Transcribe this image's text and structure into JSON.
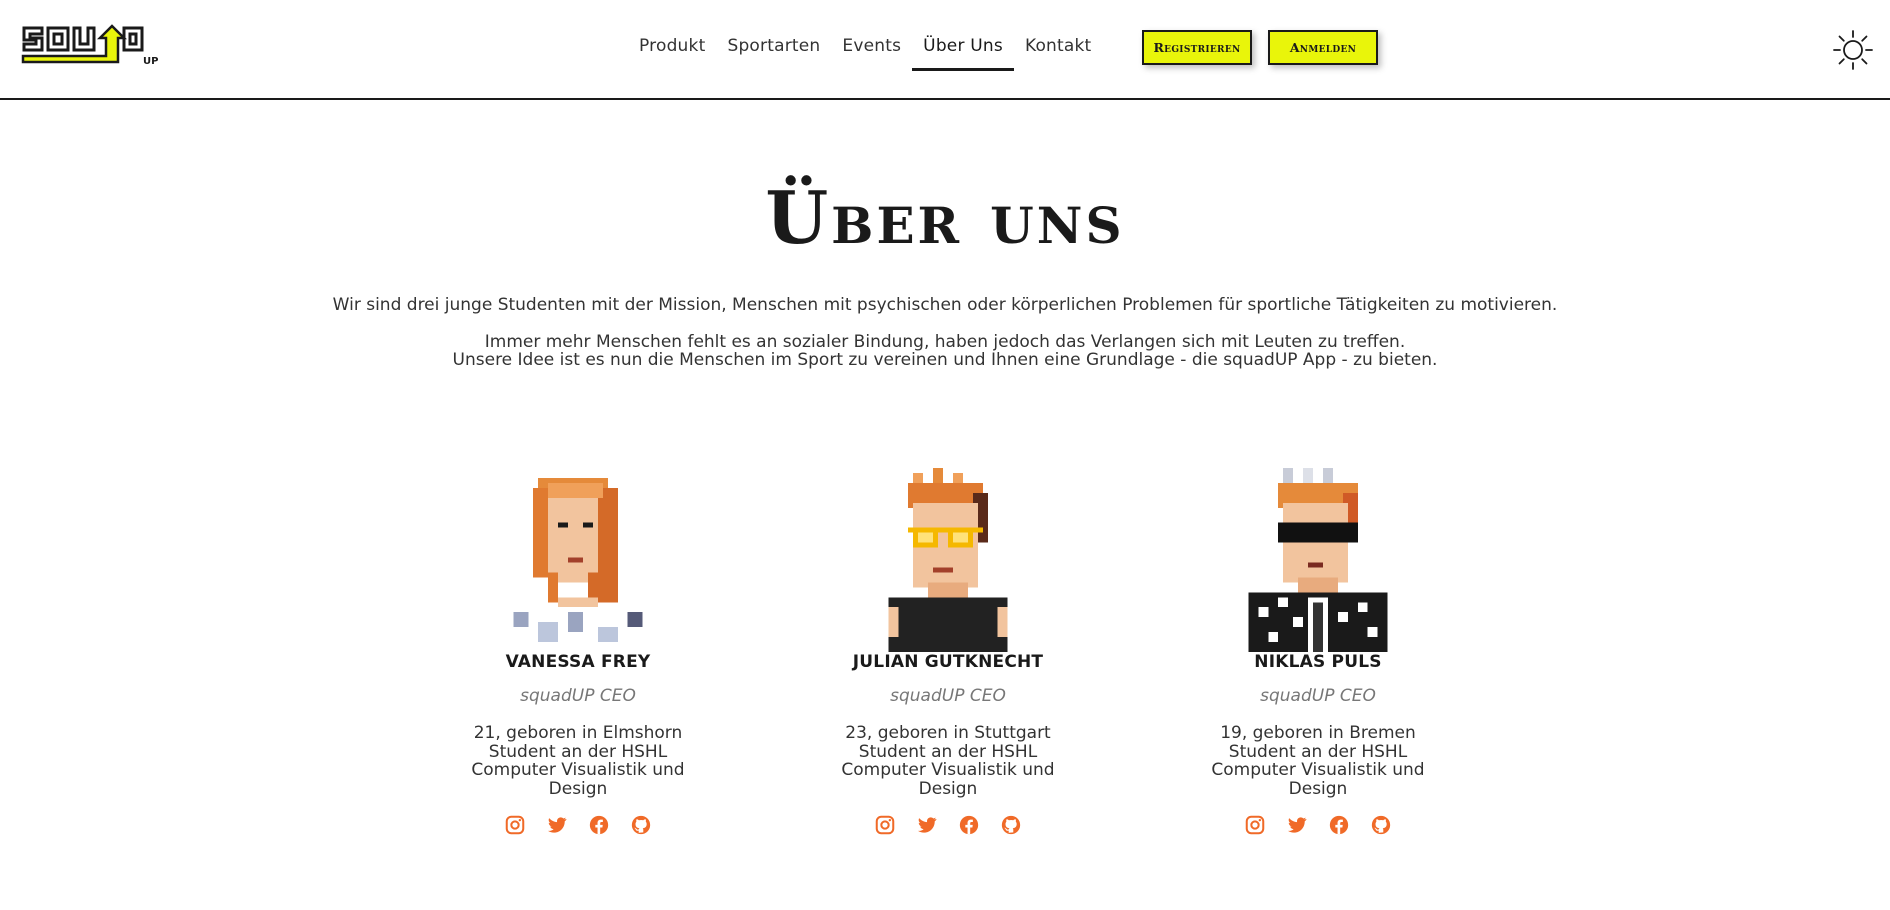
{
  "nav": {
    "items": [
      {
        "label": "Produkt",
        "active": false
      },
      {
        "label": "Sportarten",
        "active": false
      },
      {
        "label": "Events",
        "active": false
      },
      {
        "label": "Über Uns",
        "active": true
      },
      {
        "label": "Kontakt",
        "active": false
      }
    ]
  },
  "buttons": {
    "register": "Registrieren",
    "login": "Anmelden"
  },
  "logo": {
    "text": "SQUAD",
    "sub": "UP"
  },
  "page": {
    "title": "Über uns",
    "intro_1": "Wir sind drei junge Studenten mit der Mission, Menschen mit psychischen oder körperlichen Problemen für sportliche Tätigkeiten zu motivieren.",
    "intro_2": "Immer mehr Menschen fehlt es an sozialer Bindung, haben jedoch das Verlangen sich mit Leuten zu treffen.",
    "intro_3": "Unsere Idee ist es nun die Menschen im Sport zu vereinen und Ihnen eine Grundlage - die squadUP App - zu bieten."
  },
  "team": [
    {
      "name": "VANESSA FREY",
      "role": "squadUP CEO",
      "bio_1": "21, geboren in Elmshorn",
      "bio_2": "Student an der HSHL",
      "bio_3": "Computer Visualistik und",
      "bio_4": "Design"
    },
    {
      "name": "JULIAN GUTKNECHT",
      "role": "squadUP CEO",
      "bio_1": "23, geboren in Stuttgart",
      "bio_2": "Student an der HSHL",
      "bio_3": "Computer Visualistik und",
      "bio_4": "Design"
    },
    {
      "name": "NIKLAS PULS",
      "role": "squadUP CEO",
      "bio_1": "19, geboren in Bremen",
      "bio_2": "Student an der HSHL",
      "bio_3": "Computer Visualistik und",
      "bio_4": "Design"
    }
  ],
  "icons": {
    "theme": "sun-icon",
    "socials": [
      "instagram-icon",
      "twitter-icon",
      "facebook-icon",
      "github-icon"
    ]
  },
  "colors": {
    "accent": "#e9f50a",
    "social": "#f06a28",
    "text": "#1a1a1a"
  }
}
